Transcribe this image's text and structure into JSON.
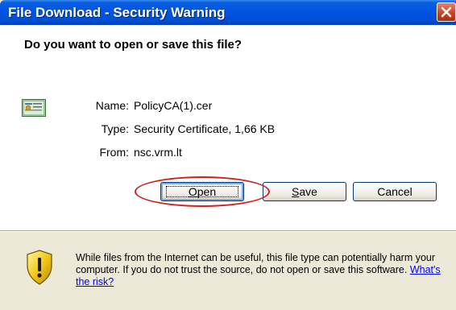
{
  "window": {
    "title": "File Download - Security Warning"
  },
  "dialog": {
    "question": "Do you want to open or save this file?",
    "file_info": {
      "name_label": "Name:",
      "name_value": "PolicyCA(1).cer",
      "type_label": "Type:",
      "type_value": "Security Certificate, 1,66 KB",
      "from_label": "From:",
      "from_value": "nsc.vrm.lt"
    },
    "buttons": {
      "open_mnemonic": "O",
      "open_rest": "pen",
      "save_mnemonic": "S",
      "save_rest": "ave",
      "cancel": "Cancel"
    },
    "warning": {
      "text": "While files from the Internet can be useful, this file type can potentially harm your computer. If you do not trust the source, do not open or save this software.",
      "link": "What's the risk?"
    }
  },
  "icons": {
    "close": "close-icon",
    "certificate": "certificate-icon",
    "shield": "shield-warning-icon"
  },
  "colors": {
    "titlebar": "#0054e3",
    "highlight_ellipse": "#d12020",
    "link": "#0000ff"
  }
}
